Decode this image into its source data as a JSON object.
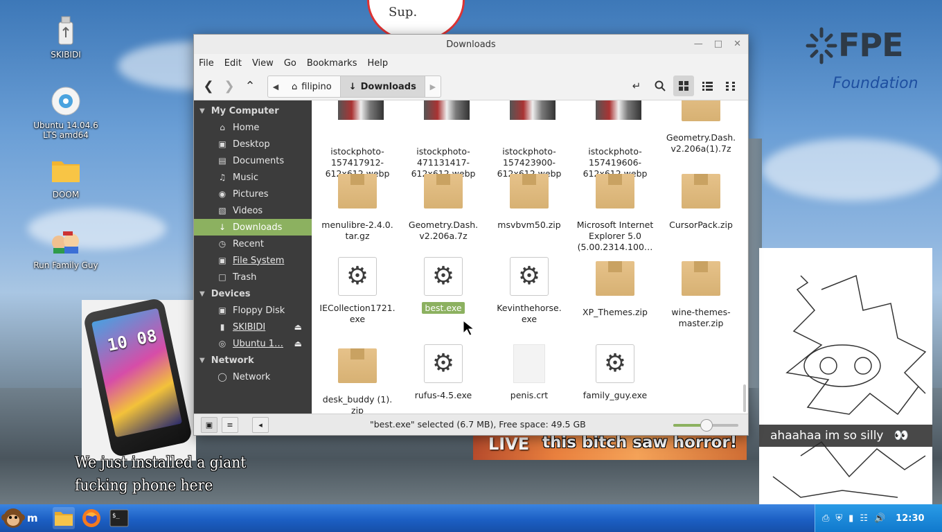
{
  "desktop": {
    "icons": [
      {
        "label": "SKIBIDI",
        "icon": "usb-drive-icon"
      },
      {
        "label": "Ubuntu 14.04.6 LTS amd64",
        "icon": "cd-disc-icon"
      },
      {
        "label": "DOOM",
        "icon": "folder-icon"
      },
      {
        "label": "Run Family Guy",
        "icon": "family-guy-icon"
      }
    ],
    "phone_meme_caption_1": "We just installed a giant",
    "phone_meme_caption_2": "fucking phone here",
    "phone_clock": "10 08",
    "live_badge": "LIVE",
    "live_caption": "this bitch saw horror!",
    "sketch_caption": "ahaahaa im so silly",
    "logo_main": "FPE",
    "logo_sub": "Foundation",
    "top_circle_text": "Sup."
  },
  "window": {
    "title": "Downloads",
    "menu": [
      "File",
      "Edit",
      "View",
      "Go",
      "Bookmarks",
      "Help"
    ],
    "breadcrumbs": [
      {
        "label": "filipino",
        "icon": "home-icon"
      },
      {
        "label": "Downloads",
        "icon": "download-arrow-icon"
      }
    ]
  },
  "sidebar": {
    "sections": [
      {
        "title": "My Computer",
        "items": [
          {
            "label": "Home",
            "icon": "home-icon"
          },
          {
            "label": "Desktop",
            "icon": "desktop-icon"
          },
          {
            "label": "Documents",
            "icon": "documents-icon"
          },
          {
            "label": "Music",
            "icon": "music-icon"
          },
          {
            "label": "Pictures",
            "icon": "camera-icon"
          },
          {
            "label": "Videos",
            "icon": "film-icon"
          },
          {
            "label": "Downloads",
            "icon": "download-arrow-icon",
            "active": true
          },
          {
            "label": "Recent",
            "icon": "clock-icon"
          },
          {
            "label": "File System",
            "icon": "drive-icon"
          },
          {
            "label": "Trash",
            "icon": "trash-icon"
          }
        ]
      },
      {
        "title": "Devices",
        "items": [
          {
            "label": "Floppy Disk",
            "icon": "floppy-icon"
          },
          {
            "label": "SKIBIDI",
            "icon": "usb-icon",
            "eject": true
          },
          {
            "label": "Ubuntu 1…",
            "icon": "disc-icon",
            "eject": true
          }
        ]
      },
      {
        "title": "Network",
        "items": [
          {
            "label": "Network",
            "icon": "globe-icon"
          }
        ]
      }
    ]
  },
  "files": [
    {
      "name": "istockphoto-157417912-612x612.webp",
      "label": "istockphoto-\n157417912-\n612x612.webp",
      "type": "image"
    },
    {
      "name": "istockphoto-471131417-612x612.webp",
      "label": "istockphoto-\n471131417-\n612x612.webp",
      "type": "image"
    },
    {
      "name": "istockphoto-157423900-612x612.webp",
      "label": "istockphoto-\n157423900-\n612x612.webp",
      "type": "image"
    },
    {
      "name": "istockphoto-157419606-612x612.webp",
      "label": "istockphoto-\n157419606-\n612x612.webp",
      "type": "image"
    },
    {
      "name": "Geometry.Dash.v2.206a(1).7z",
      "label": "Geometry.Dash.\nv2.206a(1).7z",
      "type": "archive"
    },
    {
      "name": "menulibre-2.4.0.tar.gz",
      "label": "menulibre-2.4.0.\ntar.gz",
      "type": "archive"
    },
    {
      "name": "Geometry.Dash.v2.206a.7z",
      "label": "Geometry.Dash.\nv2.206a.7z",
      "type": "archive"
    },
    {
      "name": "msvbvm50.zip",
      "label": "msvbvm50.zip",
      "type": "archive"
    },
    {
      "name": "Microsoft Internet Explorer 5.0",
      "label": "Microsoft Internet\nExplorer 5.0\n(5.00.2314.100…",
      "type": "archive"
    },
    {
      "name": "CursorPack.zip",
      "label": "CursorPack.zip",
      "type": "archive"
    },
    {
      "name": "IECollection1721.exe",
      "label": "IECollection1721.\nexe",
      "type": "exe"
    },
    {
      "name": "best.exe",
      "label": "best.exe",
      "type": "exe",
      "selected": true
    },
    {
      "name": "Kevinthehorse.exe",
      "label": "Kevinthehorse.\nexe",
      "type": "exe"
    },
    {
      "name": "XP_Themes.zip",
      "label": "XP_Themes.zip",
      "type": "archive"
    },
    {
      "name": "wine-themes-master.zip",
      "label": "wine-themes-\nmaster.zip",
      "type": "archive"
    },
    {
      "name": "desk_buddy (1).zip",
      "label": "desk_buddy (1).\nzip",
      "type": "archive"
    },
    {
      "name": "rufus-4.5.exe",
      "label": "rufus-4.5.exe",
      "type": "exe"
    },
    {
      "name": "penis.crt",
      "label": "penis.crt",
      "type": "document"
    },
    {
      "name": "family_guy.exe",
      "label": "family_guy.exe",
      "type": "exe"
    }
  ],
  "statusbar": {
    "text": "\"best.exe\" selected (6.7 MB), Free space: 49.5 GB",
    "zoom_fraction": 0.5
  },
  "taskbar": {
    "start_label": "m",
    "apps": [
      "folder-icon",
      "firefox-icon",
      "terminal-icon"
    ],
    "tray_icons": [
      "clipboard-icon",
      "shield-icon",
      "battery-icon",
      "network-icon",
      "volume-icon"
    ],
    "clock": "12:30"
  },
  "colors": {
    "accent_green": "#8cb160",
    "sidebar_bg": "#3c3c3c",
    "taskbar_blue": "#1c5fc4"
  }
}
